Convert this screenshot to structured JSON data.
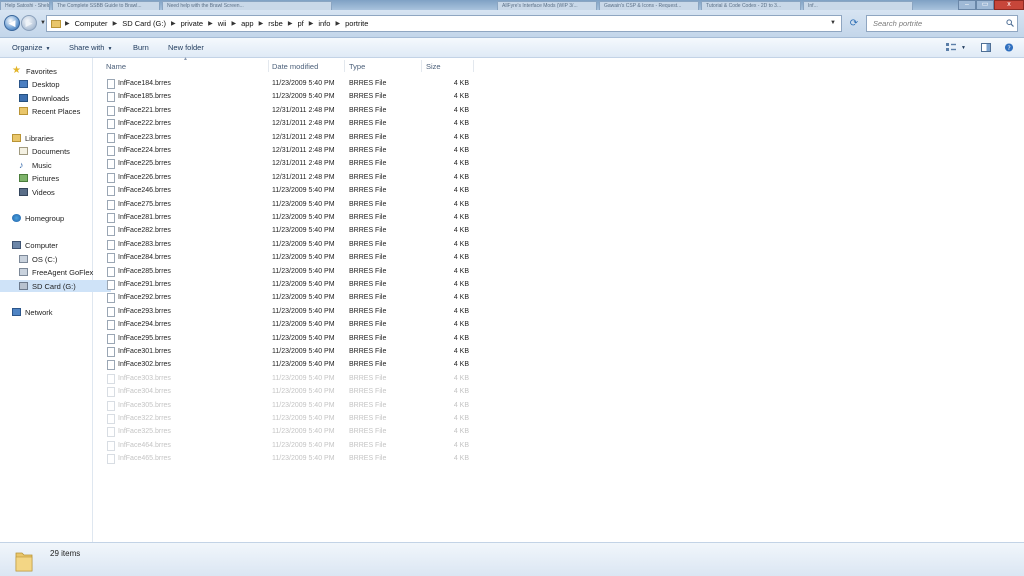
{
  "browser_tabs": [
    "Help Satoshi - Sheldamnd.com",
    "The Complete SSBB Guide to Brawl...",
    "Need help with the Brawl Screen...",
    "AllFyre's Interface Mods (WIP 3/...",
    "Gawain's CSP & Icons - Request...",
    "Tutorial & Code Codex - 2D to 3...",
    "Inf..."
  ],
  "window_controls": {
    "minimize": "–",
    "maximize": "▭",
    "close": "x"
  },
  "breadcrumb": [
    "Computer",
    "SD Card (G:)",
    "private",
    "wii",
    "app",
    "rsbe",
    "pf",
    "info",
    "portrite"
  ],
  "search": {
    "placeholder": "Search portrite"
  },
  "toolbar": {
    "organize": "Organize",
    "share_with": "Share with",
    "burn": "Burn",
    "new_folder": "New folder"
  },
  "nav": {
    "items": [
      {
        "label": "Favorites",
        "icon": "star-icon",
        "indent": 0
      },
      {
        "label": "Desktop",
        "icon": "desktop-icon",
        "indent": 1
      },
      {
        "label": "Downloads",
        "icon": "downloads-icon",
        "indent": 1
      },
      {
        "label": "Recent Places",
        "icon": "recent-places-icon",
        "indent": 1
      },
      {
        "label": "Libraries",
        "icon": "libraries-icon",
        "indent": 0
      },
      {
        "label": "Documents",
        "icon": "documents-icon",
        "indent": 1
      },
      {
        "label": "Music",
        "icon": "music-icon",
        "indent": 1
      },
      {
        "label": "Pictures",
        "icon": "pictures-icon",
        "indent": 1
      },
      {
        "label": "Videos",
        "icon": "videos-icon",
        "indent": 1
      },
      {
        "label": "Homegroup",
        "icon": "homegroup-icon",
        "indent": 0
      },
      {
        "label": "Computer",
        "icon": "computer-icon",
        "indent": 0
      },
      {
        "label": "OS (C:)",
        "icon": "drive-icon",
        "indent": 1
      },
      {
        "label": "FreeAgent GoFlex",
        "icon": "drive-icon",
        "indent": 1
      },
      {
        "label": "SD Card (G:)",
        "icon": "sd-card-icon",
        "indent": 1,
        "selected": true
      },
      {
        "label": "Network",
        "icon": "network-icon",
        "indent": 0
      }
    ]
  },
  "columns": {
    "name": "Name",
    "date": "Date modified",
    "type": "Type",
    "size": "Size"
  },
  "files": [
    {
      "name": "InfFace184.brres",
      "date": "11/23/2009 5:40 PM",
      "type": "BRRES File",
      "size": "4 KB"
    },
    {
      "name": "InfFace185.brres",
      "date": "11/23/2009 5:40 PM",
      "type": "BRRES File",
      "size": "4 KB"
    },
    {
      "name": "InfFace221.brres",
      "date": "12/31/2011 2:48 PM",
      "type": "BRRES File",
      "size": "4 KB"
    },
    {
      "name": "InfFace222.brres",
      "date": "12/31/2011 2:48 PM",
      "type": "BRRES File",
      "size": "4 KB"
    },
    {
      "name": "InfFace223.brres",
      "date": "12/31/2011 2:48 PM",
      "type": "BRRES File",
      "size": "4 KB"
    },
    {
      "name": "InfFace224.brres",
      "date": "12/31/2011 2:48 PM",
      "type": "BRRES File",
      "size": "4 KB"
    },
    {
      "name": "InfFace225.brres",
      "date": "12/31/2011 2:48 PM",
      "type": "BRRES File",
      "size": "4 KB"
    },
    {
      "name": "InfFace226.brres",
      "date": "12/31/2011 2:48 PM",
      "type": "BRRES File",
      "size": "4 KB"
    },
    {
      "name": "InfFace246.brres",
      "date": "11/23/2009 5:40 PM",
      "type": "BRRES File",
      "size": "4 KB"
    },
    {
      "name": "InfFace275.brres",
      "date": "11/23/2009 5:40 PM",
      "type": "BRRES File",
      "size": "4 KB"
    },
    {
      "name": "InfFace281.brres",
      "date": "11/23/2009 5:40 PM",
      "type": "BRRES File",
      "size": "4 KB"
    },
    {
      "name": "InfFace282.brres",
      "date": "11/23/2009 5:40 PM",
      "type": "BRRES File",
      "size": "4 KB"
    },
    {
      "name": "InfFace283.brres",
      "date": "11/23/2009 5:40 PM",
      "type": "BRRES File",
      "size": "4 KB"
    },
    {
      "name": "InfFace284.brres",
      "date": "11/23/2009 5:40 PM",
      "type": "BRRES File",
      "size": "4 KB"
    },
    {
      "name": "InfFace285.brres",
      "date": "11/23/2009 5:40 PM",
      "type": "BRRES File",
      "size": "4 KB"
    },
    {
      "name": "InfFace291.brres",
      "date": "11/23/2009 5:40 PM",
      "type": "BRRES File",
      "size": "4 KB"
    },
    {
      "name": "InfFace292.brres",
      "date": "11/23/2009 5:40 PM",
      "type": "BRRES File",
      "size": "4 KB"
    },
    {
      "name": "InfFace293.brres",
      "date": "11/23/2009 5:40 PM",
      "type": "BRRES File",
      "size": "4 KB"
    },
    {
      "name": "InfFace294.brres",
      "date": "11/23/2009 5:40 PM",
      "type": "BRRES File",
      "size": "4 KB"
    },
    {
      "name": "InfFace295.brres",
      "date": "11/23/2009 5:40 PM",
      "type": "BRRES File",
      "size": "4 KB"
    },
    {
      "name": "InfFace301.brres",
      "date": "11/23/2009 5:40 PM",
      "type": "BRRES File",
      "size": "4 KB"
    },
    {
      "name": "InfFace302.brres",
      "date": "11/23/2009 5:40 PM",
      "type": "BRRES File",
      "size": "4 KB"
    },
    {
      "name": "InfFace303.brres",
      "date": "11/23/2009 5:40 PM",
      "type": "BRRES File",
      "size": "4 KB"
    },
    {
      "name": "InfFace304.brres",
      "date": "11/23/2009 5:40 PM",
      "type": "BRRES File",
      "size": "4 KB"
    },
    {
      "name": "InfFace305.brres",
      "date": "11/23/2009 5:40 PM",
      "type": "BRRES File",
      "size": "4 KB"
    },
    {
      "name": "InfFace322.brres",
      "date": "11/23/2009 5:40 PM",
      "type": "BRRES File",
      "size": "4 KB"
    },
    {
      "name": "InfFace325.brres",
      "date": "11/23/2009 5:40 PM",
      "type": "BRRES File",
      "size": "4 KB"
    },
    {
      "name": "InfFace464.brres",
      "date": "11/23/2009 5:40 PM",
      "type": "BRRES File",
      "size": "4 KB"
    },
    {
      "name": "InfFace465.brres",
      "date": "11/23/2009 5:40 PM",
      "type": "BRRES File",
      "size": "4 KB"
    }
  ],
  "status": {
    "item_count": "29 items"
  },
  "colors": {
    "accent": "#cfe3f8",
    "text": "#1e1e1e",
    "faded_text": "#c4c4c4",
    "folder": "#e9c66b"
  }
}
